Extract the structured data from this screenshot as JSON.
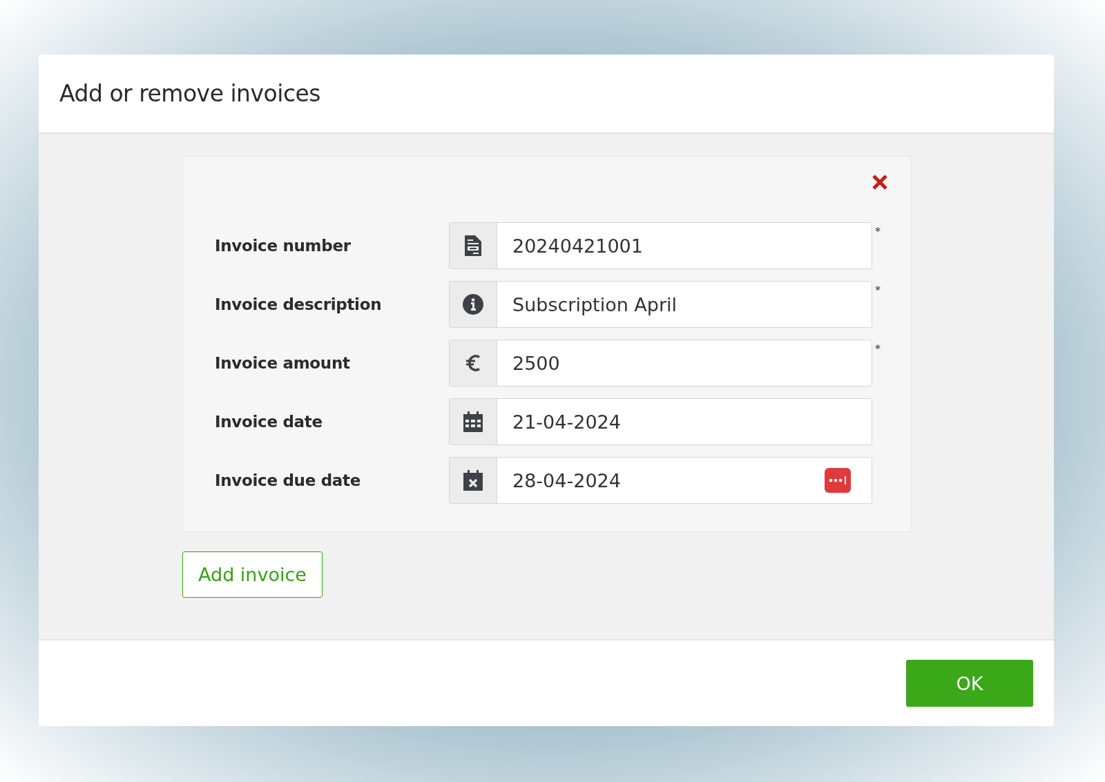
{
  "dialog": {
    "title": "Add or remove invoices"
  },
  "invoice": {
    "fields": [
      {
        "label": "Invoice number",
        "kind": "document",
        "value": "20240421001",
        "required_mark": "*",
        "badge": false
      },
      {
        "label": "Invoice description",
        "kind": "info",
        "value": "Subscription April",
        "required_mark": "*",
        "badge": false
      },
      {
        "label": "Invoice amount",
        "kind": "euro",
        "value": "2500",
        "required_mark": "*",
        "badge": false
      },
      {
        "label": "Invoice date",
        "kind": "calendar",
        "value": "21-04-2024",
        "badge": false
      },
      {
        "label": "Invoice due date",
        "kind": "calendar-x",
        "value": "28-04-2024",
        "badge": true
      }
    ]
  },
  "add_button": "Add invoice",
  "ok_button": "OK"
}
